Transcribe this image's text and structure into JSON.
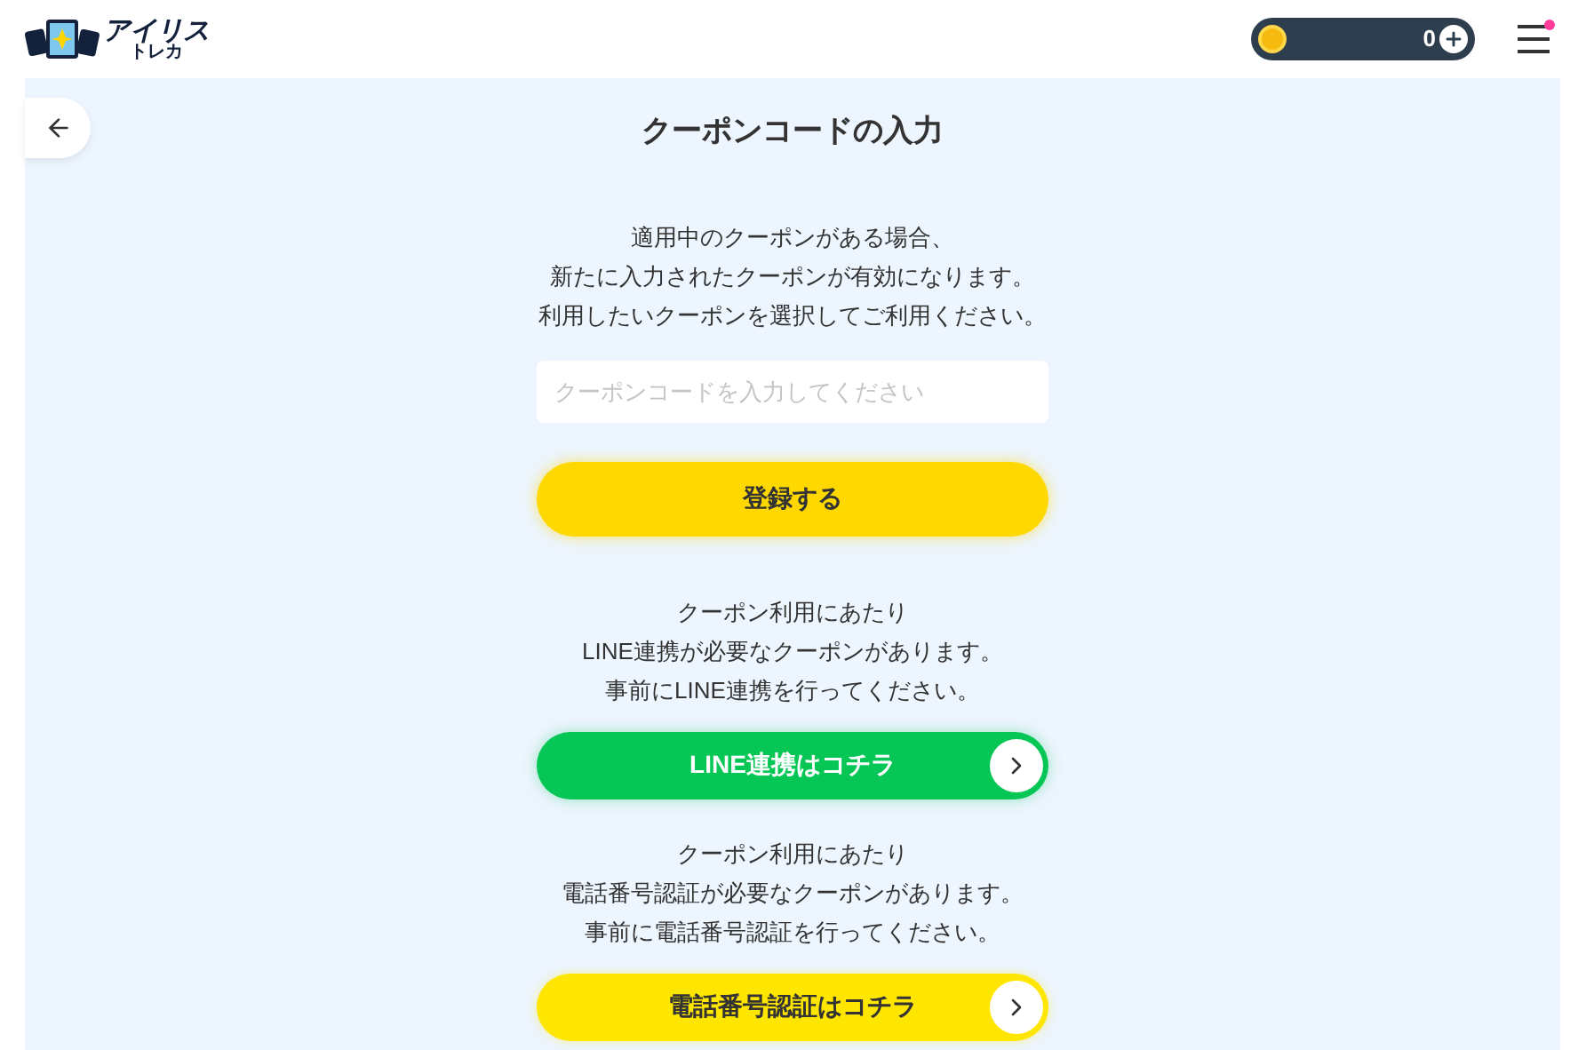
{
  "header": {
    "logo_title": "アイリス",
    "logo_subtitle": "トレカ",
    "coin_balance": "0",
    "menu_notification": true
  },
  "page": {
    "title": "クーポンコードの入力",
    "notice": [
      "適用中のクーポンがある場合、",
      "新たに入力されたクーポンが有効になります。",
      "利用したいクーポンを選択してご利用ください。"
    ],
    "coupon_field": {
      "placeholder": "クーポンコードを入力してください"
    },
    "submit_button": "登録する",
    "links": [
      {
        "kind": "line",
        "notice": [
          "クーポン利用にあたり",
          "LINE連携が必要なクーポンがあります。",
          "事前にLINE連携を行ってください。"
        ],
        "button": "LINE連携はコチラ"
      },
      {
        "kind": "phone",
        "notice": [
          "クーポン利用にあたり",
          "電話番号認証が必要なクーポンがあります。",
          "事前に電話番号認証を行ってください。"
        ],
        "button": "電話番号認証はコチラ"
      }
    ]
  }
}
